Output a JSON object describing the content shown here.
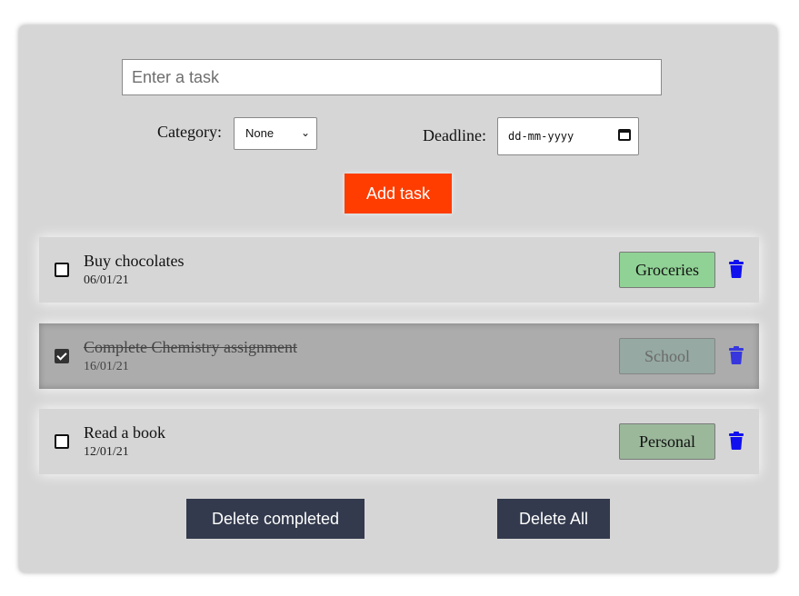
{
  "input": {
    "placeholder": "Enter a task",
    "value": ""
  },
  "category": {
    "label": "Category:",
    "selected": "None",
    "chevron": "⌄"
  },
  "deadline": {
    "label": "Deadline:",
    "placeholder": "dd-mm-yyyy"
  },
  "add_button": "Add task",
  "tasks": [
    {
      "name": "Buy chocolates",
      "date": "06/01/21",
      "category": "Groceries",
      "completed": false,
      "tag_color": "#90d295"
    },
    {
      "name": "Complete Chemistry assignment",
      "date": "16/01/21",
      "category": "School",
      "completed": true,
      "tag_color": "#8fa9a0"
    },
    {
      "name": "Read a book",
      "date": "12/01/21",
      "category": "Personal",
      "completed": false,
      "tag_color": "#9bb89b"
    }
  ],
  "footer": {
    "delete_completed": "Delete completed",
    "delete_all": "Delete All"
  },
  "colors": {
    "accent": "#ff3d00",
    "trash": "#1010ee",
    "footer_button": "#333a4d"
  },
  "icons": {
    "trash": "trash-icon",
    "calendar": "calendar-icon",
    "checkbox": "checkbox-icon"
  }
}
